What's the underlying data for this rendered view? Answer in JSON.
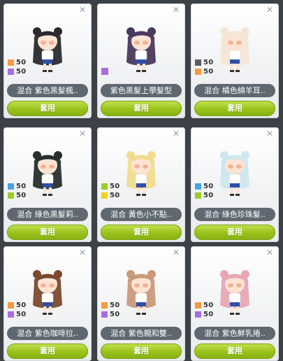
{
  "colors": {
    "orange": "#f59a3e",
    "purple": "#a86de0",
    "gray": "#5c5c5c",
    "blue": "#4aa3e8",
    "green": "#9bcb2a",
    "yellow": "#f2d21f"
  },
  "items": [
    {
      "name": "混合  紫色黑髮楓..",
      "apply": "套用",
      "hair": "#2b2a2e",
      "stats": [
        {
          "color": "#f59a3e",
          "value": "50"
        },
        {
          "color": "#a86de0",
          "value": "50"
        }
      ],
      "single": null
    },
    {
      "name": "紫色黑髮上學髮型",
      "apply": "套用",
      "hair": "#4a3a5e",
      "stats": [],
      "single": "#a86de0"
    },
    {
      "name": "混合  橘色綿羊耳..",
      "apply": "套用",
      "hair": "#f3e6d6",
      "stats": [
        {
          "color": "#5c5c5c",
          "value": "50"
        },
        {
          "color": "#f59a3e",
          "value": "50"
        }
      ],
      "single": null
    },
    {
      "name": "混合  綠色黑髮莉..",
      "apply": "套用",
      "hair": "#27302c",
      "stats": [
        {
          "color": "#4aa3e8",
          "value": "50"
        },
        {
          "color": "#9bcb2a",
          "value": "50"
        }
      ],
      "single": null
    },
    {
      "name": "混合  黃色小不點..",
      "apply": "套用",
      "hair": "#f0dc8e",
      "stats": [
        {
          "color": "#9bcb2a",
          "value": "50"
        },
        {
          "color": "#f2d21f",
          "value": "50"
        }
      ],
      "single": null
    },
    {
      "name": "混合  綠色珍珠髮..",
      "apply": "套用",
      "hair": "#cfe6ee",
      "stats": [
        {
          "color": "#4aa3e8",
          "value": "50"
        },
        {
          "color": "#9bcb2a",
          "value": "50"
        }
      ],
      "single": null
    },
    {
      "name": "混合  紫色咖啡拉..",
      "apply": "套用",
      "hair": "#7a4a2e",
      "stats": [
        {
          "color": "#f59a3e",
          "value": "50"
        },
        {
          "color": "#a86de0",
          "value": "50"
        }
      ],
      "single": null
    },
    {
      "name": "混合  紫色親和雙..",
      "apply": "套用",
      "hair": "#c99a7a",
      "stats": [
        {
          "color": "#f59a3e",
          "value": "50"
        },
        {
          "color": "#a86de0",
          "value": "50"
        }
      ],
      "single": null
    },
    {
      "name": "混合  紫色鮮乳捲..",
      "apply": "套用",
      "hair": "#e7a7b6",
      "stats": [
        {
          "color": "#f59a3e",
          "value": "50"
        },
        {
          "color": "#a86de0",
          "value": "50"
        }
      ],
      "single": null
    }
  ]
}
